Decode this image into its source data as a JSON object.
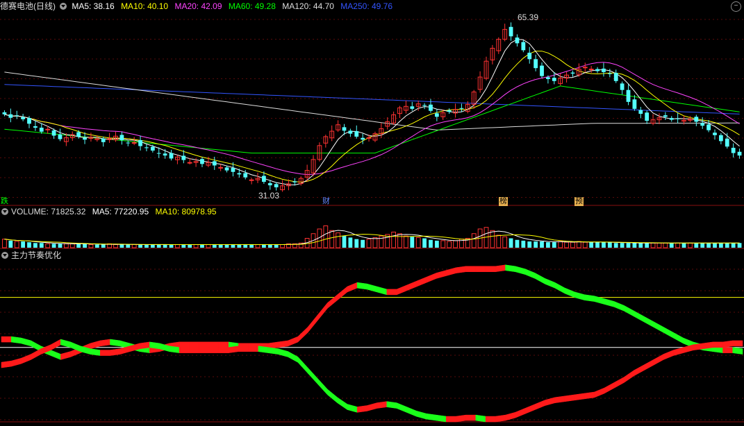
{
  "main_header": {
    "title": "德赛电池(日线)",
    "ma5": "MA5: 38.16",
    "ma10": "MA10: 40.10",
    "ma20": "MA20: 42.09",
    "ma60": "MA60: 49.28",
    "ma120": "MA120: 44.70",
    "ma250": "MA250: 49.76",
    "colors": {
      "ma5": "#ffffff",
      "ma10": "#ffff00",
      "ma20": "#ff44ff",
      "ma60": "#00ff00",
      "ma120": "#dddddd",
      "ma250": "#3355ff"
    }
  },
  "volume_header": {
    "label": "VOLUME: 71825.32",
    "ma5": "MA5: 77220.95",
    "ma10": "MA10: 80978.95"
  },
  "indicator_header": {
    "title": "主力节奏优化"
  },
  "annotations": {
    "high": "65.39",
    "low": "31.03"
  },
  "events": [
    {
      "label": "跌",
      "x": 2,
      "color": "#00ff00"
    },
    {
      "label": "财",
      "x": 463,
      "color": "#6688ff"
    },
    {
      "label": "榜",
      "x": 718,
      "color": "#ffcc66"
    },
    {
      "label": "预",
      "x": 827,
      "color": "#ffcc66"
    }
  ],
  "chart_data": {
    "type": "candlestick",
    "price_range": [
      29,
      67
    ],
    "ma_series": [
      {
        "name": "MA5",
        "color": "#ffffff"
      },
      {
        "name": "MA10",
        "color": "#ffff00"
      },
      {
        "name": "MA20",
        "color": "#ff44ff"
      },
      {
        "name": "MA60",
        "color": "#00ff00"
      },
      {
        "name": "MA120",
        "color": "#dddddd"
      },
      {
        "name": "MA250",
        "color": "#3355ff"
      }
    ],
    "close": [
      46.5,
      45.8,
      46.2,
      45.5,
      44.6,
      43.8,
      43.0,
      43.5,
      42.2,
      41.5,
      41.8,
      42.4,
      42.0,
      41.4,
      41.9,
      41.6,
      40.9,
      41.6,
      42.1,
      41.3,
      40.7,
      40.8,
      40.1,
      39.7,
      39.2,
      38.6,
      38.2,
      37.6,
      37.9,
      37.3,
      36.8,
      37.0,
      36.5,
      36.8,
      36.2,
      35.8,
      35.2,
      34.9,
      34.4,
      33.8,
      33.3,
      33.6,
      32.9,
      32.2,
      31.8,
      32.1,
      32.5,
      32.8,
      33.6,
      35.2,
      37.4,
      40.2,
      42.0,
      43.1,
      44.4,
      43.2,
      42.6,
      42.0,
      41.4,
      41.8,
      42.6,
      43.6,
      45.0,
      46.4,
      47.8,
      48.1,
      47.6,
      48.6,
      48.2,
      47.2,
      46.0,
      46.8,
      47.0,
      47.5,
      47.6,
      48.5,
      51.0,
      54.0,
      57.2,
      59.8,
      61.6,
      63.6,
      62.2,
      60.8,
      59.4,
      57.6,
      55.8,
      54.2,
      53.6,
      53.2,
      53.8,
      54.4,
      54.7,
      55.6,
      56.0,
      55.6,
      55.2,
      55.0,
      54.6,
      53.2,
      51.4,
      49.0,
      47.6,
      46.6,
      45.2,
      45.4,
      45.8,
      46.0,
      45.4,
      45.6,
      45.3,
      45.5,
      45.0,
      44.2,
      43.3,
      42.3,
      41.1,
      40.0,
      38.7,
      38.2
    ],
    "volume": [
      11,
      9,
      8,
      8,
      7,
      6,
      6,
      5,
      5,
      5,
      5,
      5,
      5,
      5,
      4,
      4,
      4,
      5,
      4,
      4,
      4,
      4,
      4,
      4,
      4,
      4,
      4,
      4,
      4,
      4,
      4,
      4,
      4,
      4,
      4,
      4,
      4,
      4,
      4,
      4,
      4,
      4,
      4,
      4,
      4,
      4,
      5,
      5,
      6,
      12,
      18,
      24,
      28,
      22,
      19,
      15,
      13,
      11,
      10,
      11,
      13,
      15,
      17,
      20,
      18,
      15,
      14,
      13,
      12,
      10,
      9,
      9,
      8,
      9,
      11,
      12,
      18,
      24,
      26,
      22,
      16,
      14,
      12,
      10,
      9,
      8,
      8,
      8,
      7,
      7,
      8,
      7,
      7,
      8,
      7,
      7,
      7,
      7,
      7,
      6,
      6,
      6,
      6,
      6,
      6,
      6,
      6,
      6,
      6,
      6,
      6,
      6,
      6,
      6,
      6,
      6,
      6,
      6,
      6,
      6
    ],
    "volume_range": [
      0,
      40
    ],
    "indicator": {
      "reference_lines": [
        {
          "value": 0.86,
          "color": "#ffff00"
        },
        {
          "value": 0.49,
          "color": "#ffffff"
        }
      ],
      "series": [
        {
          "name": "upper",
          "values": [
            0.55,
            0.55,
            0.54,
            0.52,
            0.48,
            0.45,
            0.42,
            0.44,
            0.47,
            0.5,
            0.52,
            0.53,
            0.52,
            0.5,
            0.48,
            0.47,
            0.48,
            0.5,
            0.51,
            0.51,
            0.51,
            0.51,
            0.51,
            0.51,
            0.5,
            0.5,
            0.5,
            0.5,
            0.51,
            0.52,
            0.55,
            0.62,
            0.71,
            0.8,
            0.86,
            0.92,
            0.95,
            0.94,
            0.92,
            0.9,
            0.9,
            0.93,
            0.96,
            0.99,
            1.02,
            1.04,
            1.06,
            1.07,
            1.07,
            1.07,
            1.07,
            1.08,
            1.07,
            1.05,
            1.02,
            0.98,
            0.95,
            0.91,
            0.88,
            0.86,
            0.85,
            0.83,
            0.81,
            0.78,
            0.74,
            0.7,
            0.66,
            0.62,
            0.58,
            0.54,
            0.51,
            0.49,
            0.48,
            0.47,
            0.47,
            0.46
          ]
        },
        {
          "name": "lower",
          "values": [
            0.36,
            0.37,
            0.39,
            0.42,
            0.46,
            0.49,
            0.53,
            0.51,
            0.48,
            0.46,
            0.45,
            0.45,
            0.46,
            0.48,
            0.5,
            0.51,
            0.5,
            0.48,
            0.47,
            0.47,
            0.47,
            0.47,
            0.47,
            0.47,
            0.48,
            0.48,
            0.48,
            0.47,
            0.46,
            0.44,
            0.4,
            0.32,
            0.24,
            0.16,
            0.1,
            0.05,
            0.03,
            0.04,
            0.06,
            0.07,
            0.06,
            0.03,
            0.0,
            -0.02,
            -0.03,
            -0.04,
            -0.04,
            -0.03,
            -0.03,
            -0.04,
            -0.04,
            -0.03,
            -0.01,
            0.02,
            0.05,
            0.08,
            0.1,
            0.11,
            0.12,
            0.13,
            0.14,
            0.17,
            0.21,
            0.25,
            0.3,
            0.34,
            0.38,
            0.42,
            0.45,
            0.47,
            0.49,
            0.5,
            0.51,
            0.51,
            0.52,
            0.52
          ]
        }
      ]
    }
  }
}
